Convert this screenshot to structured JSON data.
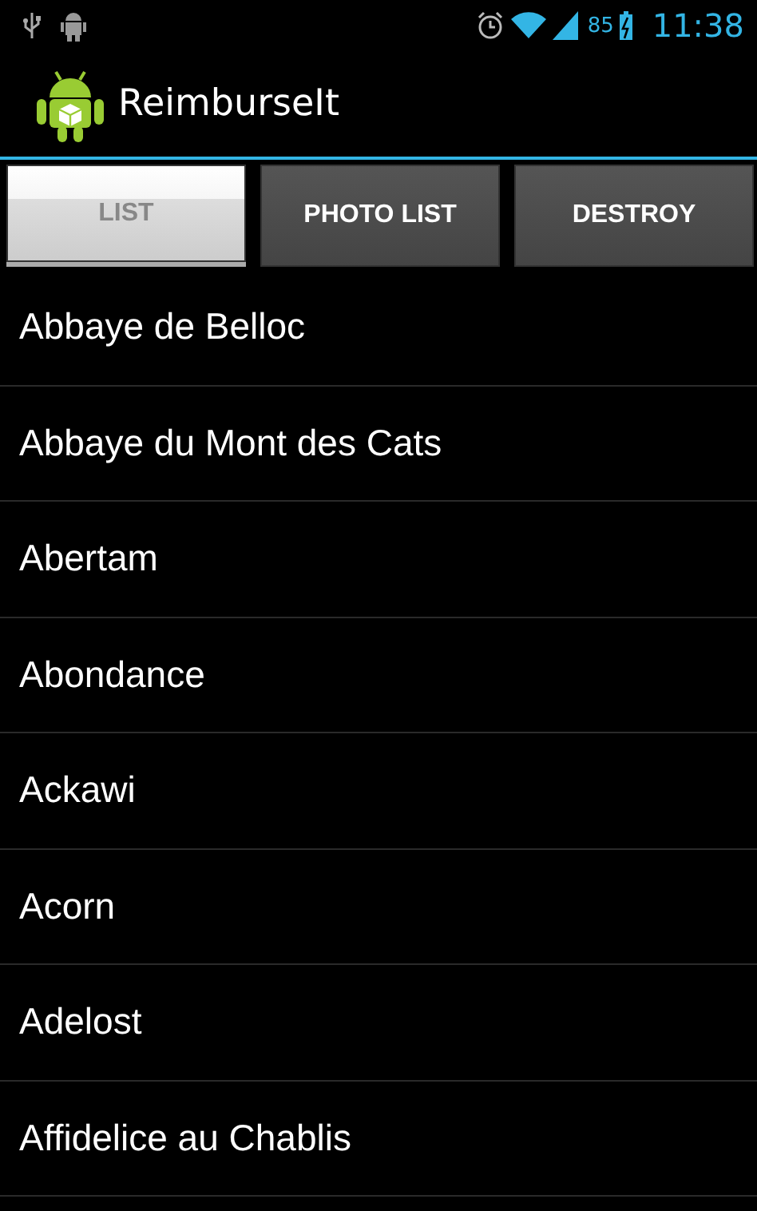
{
  "status_bar": {
    "battery": "85",
    "time": "11:38"
  },
  "action_bar": {
    "title": "ReimburseIt"
  },
  "tabs": [
    {
      "label": "LIST",
      "selected": true
    },
    {
      "label": "PHOTO LIST",
      "selected": false
    },
    {
      "label": "DESTROY",
      "selected": false
    }
  ],
  "items": [
    "Abbaye de Belloc",
    "Abbaye du Mont des Cats",
    "Abertam",
    "Abondance",
    "Ackawi",
    "Acorn",
    "Adelost",
    "Affidelice au Chablis"
  ]
}
